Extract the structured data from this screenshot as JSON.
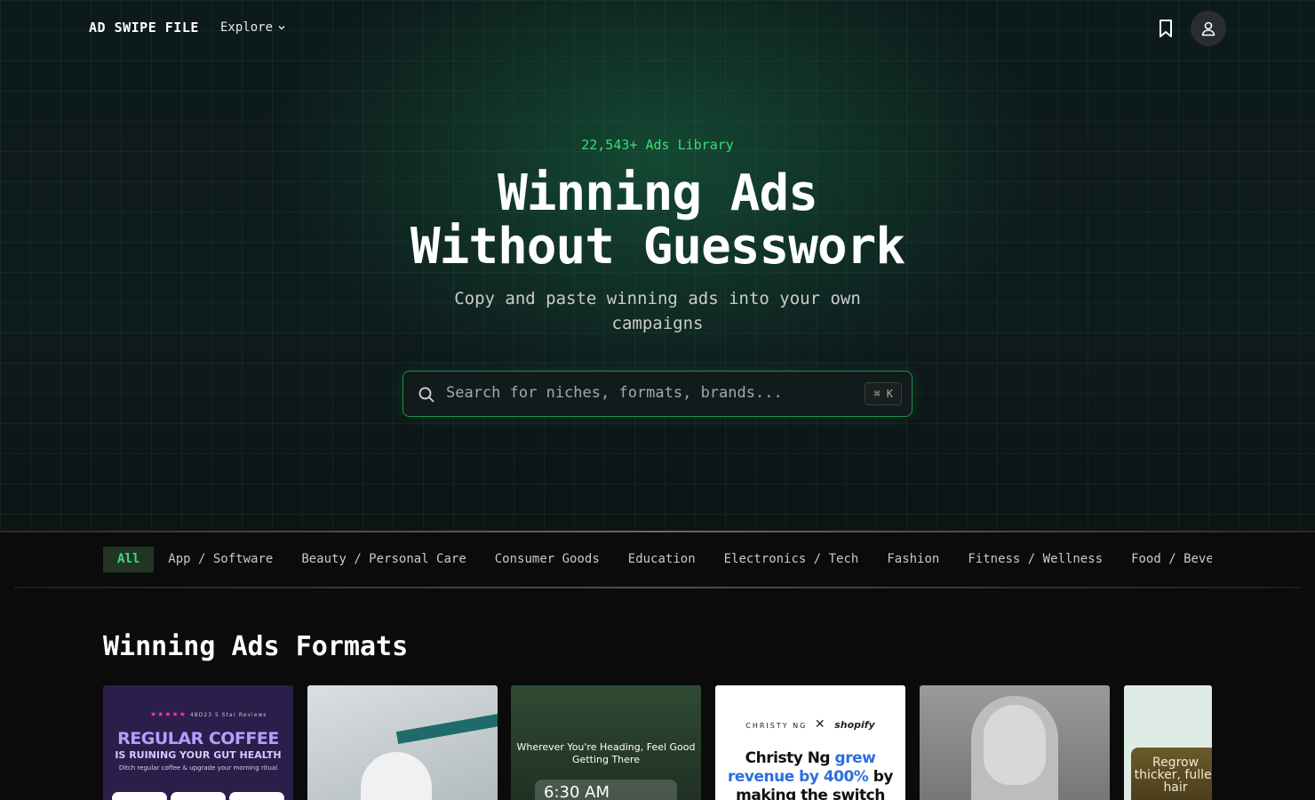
{
  "nav": {
    "logo": "AD SWIPE FILE",
    "explore_label": "Explore"
  },
  "hero": {
    "kicker": "22,543+ Ads Library",
    "headline_line1": "Winning Ads",
    "headline_line2": "Without Guesswork",
    "subline": "Copy and paste winning ads into your own campaigns"
  },
  "search": {
    "placeholder": "Search for niches, formats, brands...",
    "shortcut": "⌘ K"
  },
  "categories": [
    {
      "label": "All",
      "active": true
    },
    {
      "label": "App / Software"
    },
    {
      "label": "Beauty / Personal Care"
    },
    {
      "label": "Consumer Goods"
    },
    {
      "label": "Education"
    },
    {
      "label": "Electronics / Tech"
    },
    {
      "label": "Fashion"
    },
    {
      "label": "Fitness / Wellness"
    },
    {
      "label": "Food / Beverage"
    }
  ],
  "section": {
    "title": "Winning Ads Formats"
  },
  "cards": {
    "coffee": {
      "stars": "★★★★★",
      "reviews": "4BD23 5 Star Reviews",
      "title": "REGULAR COFFEE",
      "subtitle": "IS RUINING YOUR GUT HEALTH",
      "caption": "Ditch regular coffee & upgrade your morning ritual"
    },
    "wake": {
      "text": "Wherever You're Heading, Feel Good Getting There",
      "time": "6:30 AM"
    },
    "shopify": {
      "brand_left": "CHRISTY NG",
      "brand_sep": "✕",
      "brand_right": "shopify",
      "headline_part1": "Christy Ng ",
      "headline_blue": "grew revenue by 400%",
      "headline_part2": " by making the switch"
    },
    "hair": {
      "text": "Regrow thicker, fuller hair"
    }
  },
  "icons": {
    "bookmark": "bookmark-icon",
    "user": "user-icon",
    "search": "search-icon",
    "chevron": "chevron-down-icon"
  },
  "colors": {
    "accent": "#3ddc7a",
    "background": "#0b0b0b"
  }
}
